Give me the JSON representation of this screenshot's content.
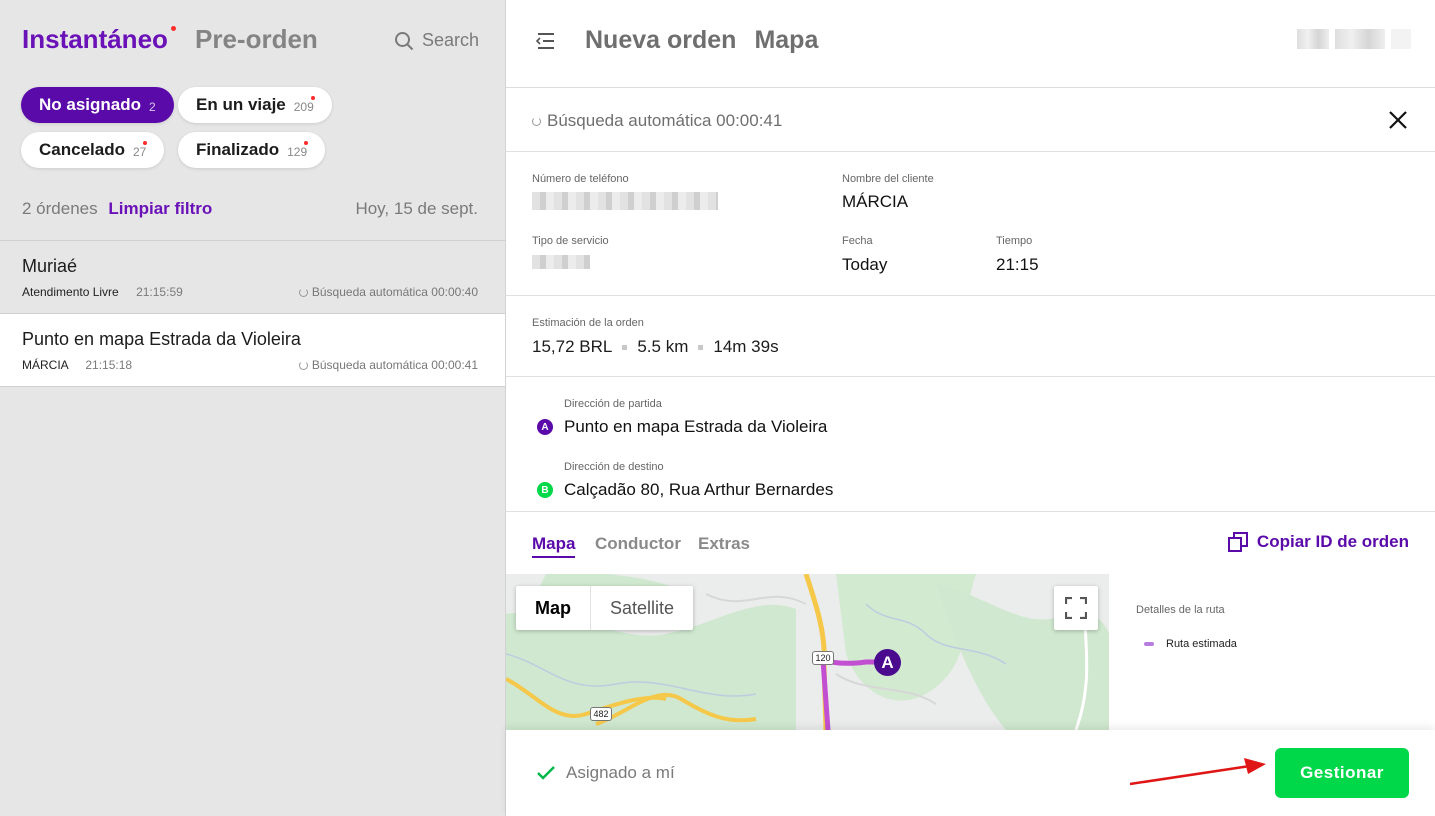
{
  "left": {
    "tabs": {
      "instant": "Instantáneo",
      "preorder": "Pre-orden"
    },
    "search_label": "Search",
    "chips": [
      {
        "label": "No asignado",
        "count": "2"
      },
      {
        "label": "En un viaje",
        "count": "209"
      },
      {
        "label": "Cancelado",
        "count": "27"
      },
      {
        "label": "Finalizado",
        "count": "129"
      }
    ],
    "filter": {
      "count_text": "2 órdenes",
      "clear_label": "Limpiar filtro",
      "date": "Hoy, 15 de sept."
    },
    "orders": [
      {
        "title": "Muriaé",
        "client": "Atendimento Livre",
        "time": "21:15:59",
        "status": "Búsqueda automática 00:00:40"
      },
      {
        "title": "Punto en mapa Estrada da Violeira",
        "client": "MÁRCIA",
        "time": "21:15:18",
        "status": "Búsqueda automática 00:00:41"
      }
    ]
  },
  "right": {
    "header": {
      "title": "Nueva orden",
      "subtitle": "Mapa"
    },
    "auto_search": "Búsqueda automática 00:00:41",
    "info": {
      "phone_label": "Número de teléfono",
      "client_label": "Nombre del cliente",
      "client_value": "MÁRCIA",
      "service_label": "Tipo de servicio",
      "date_label": "Fecha",
      "date_value": "Today",
      "time_label": "Tiempo",
      "time_value": "21:15"
    },
    "estimate": {
      "label": "Estimación de la orden",
      "price": "15,72 BRL",
      "distance": "5.5 km",
      "duration": "14m 39s"
    },
    "addresses": {
      "pickup_label": "Dirección de partida",
      "pickup_marker": "A",
      "pickup_value": "Punto en mapa Estrada da Violeira",
      "dest_label": "Dirección de destino",
      "dest_marker": "B",
      "dest_value": "Calçadão 80, Rua Arthur Bernardes"
    },
    "tabs": [
      "Mapa",
      "Conductor",
      "Extras"
    ],
    "copy_id_label": "Copiar ID de orden",
    "map": {
      "toggle_map": "Map",
      "toggle_satellite": "Satellite",
      "road_120": "120",
      "road_482": "482",
      "marker_a": "A"
    },
    "route_panel": {
      "title": "Detalles de la ruta",
      "legend": "Ruta estimada"
    },
    "footer": {
      "assigned": "Asignado a mí",
      "manage": "Gestionar"
    }
  },
  "colors": {
    "brand_purple": "#5b0aaa",
    "green": "#00d84a",
    "alert_red": "#ff2c2c",
    "route": "#c24fd1"
  }
}
